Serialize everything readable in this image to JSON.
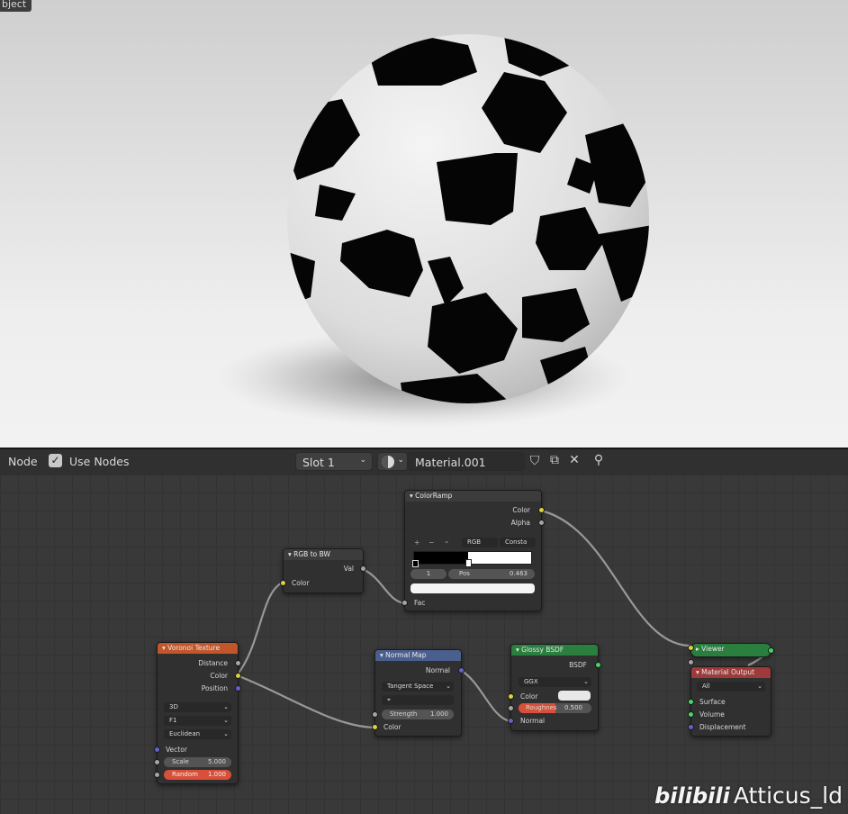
{
  "viewport": {
    "mode_label": "bject"
  },
  "header": {
    "editor_label": "Node",
    "use_nodes_label": "Use Nodes",
    "use_nodes_checked": true,
    "slot": "Slot 1",
    "material_name": "Material.001"
  },
  "nodes": {
    "colorramp": {
      "title": "ColorRamp",
      "out_color": "Color",
      "out_alpha": "Alpha",
      "add": "+",
      "remove": "−",
      "more": "⌄",
      "mode": "RGB",
      "interp": "Consta",
      "index": "1",
      "pos_label": "Pos",
      "pos_value": "0.463",
      "in_fac": "Fac"
    },
    "rgbtobw": {
      "title": "RGB to BW",
      "out_val": "Val",
      "in_color": "Color"
    },
    "voronoi": {
      "title": "Voronoi Texture",
      "out_distance": "Distance",
      "out_color": "Color",
      "out_position": "Position",
      "dim": "3D",
      "feature": "F1",
      "metric": "Euclidean",
      "in_vector": "Vector",
      "scale_label": "Scale",
      "scale_value": "5.000",
      "random_label": "Random",
      "random_value": "1.000"
    },
    "normalmap": {
      "title": "Normal Map",
      "out_normal": "Normal",
      "space": "Tangent Space",
      "uv": "⌖",
      "strength_label": "Strength",
      "strength_value": "1.000",
      "in_color": "Color"
    },
    "glossy": {
      "title": "Glossy BSDF",
      "out_bsdf": "BSDF",
      "distribution": "GGX",
      "in_color": "Color",
      "rough_label": "Roughnes",
      "rough_value": "0.500",
      "in_normal": "Normal"
    },
    "viewer": {
      "title": "Viewer"
    },
    "matout": {
      "title": "Material Output",
      "target": "All",
      "in_surface": "Surface",
      "in_volume": "Volume",
      "in_displacement": "Displacement"
    }
  },
  "watermark": {
    "logo": "bilibili",
    "author": "Atticus_ld"
  },
  "colors": {
    "voronoi_header": "#c2562a",
    "normal_header": "#4b5f8f",
    "glossy_header": "#2a7f3f",
    "output_header": "#9e3a3a",
    "socket_color": "#d8d33a",
    "socket_shader": "#4bd468",
    "socket_vector": "#6363c7"
  }
}
